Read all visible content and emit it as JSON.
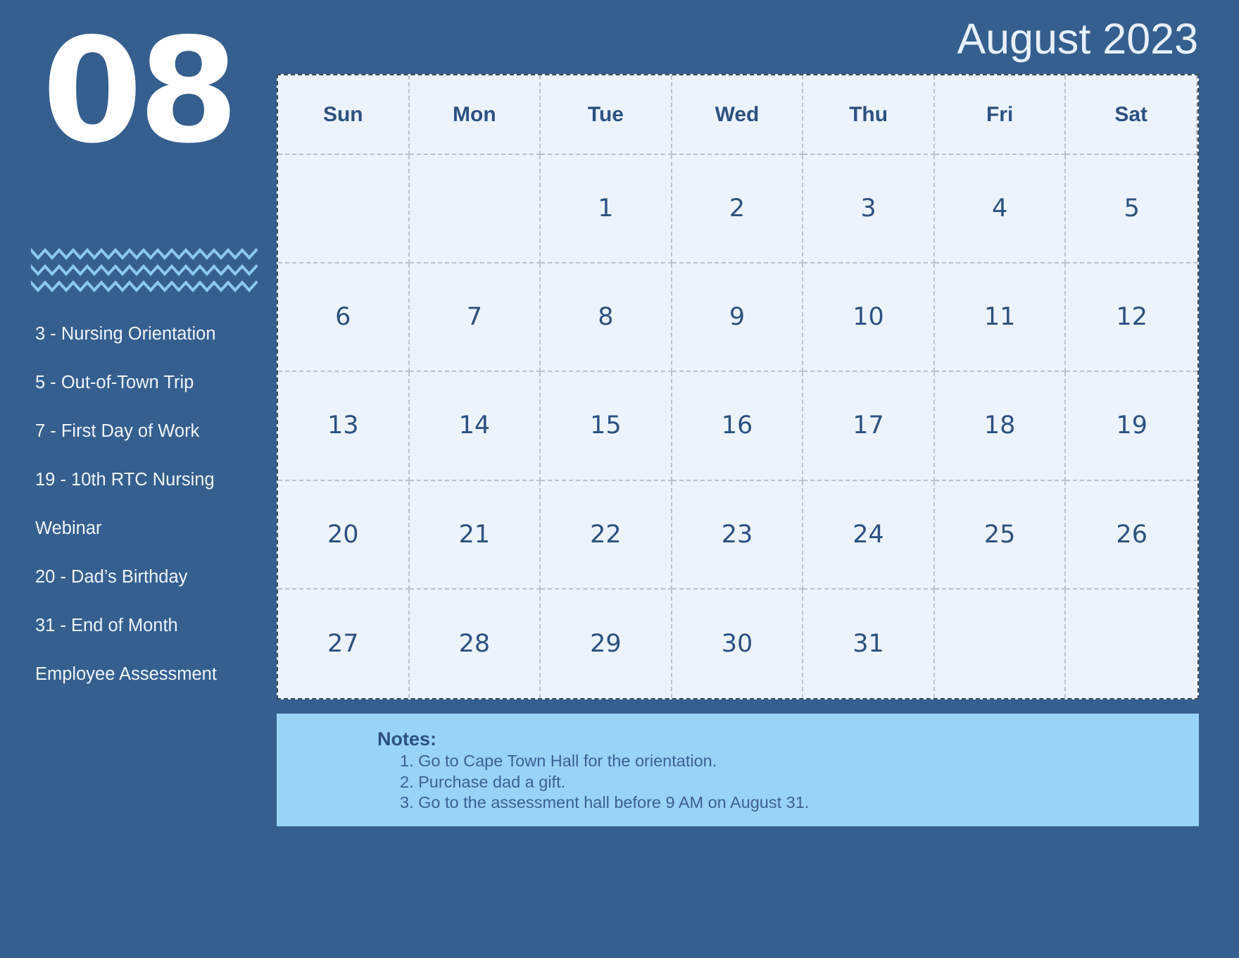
{
  "theme": {
    "background": "#355f8e",
    "grid_bg": "#edf3fc",
    "accent_text": "#2c5181",
    "notes_bg": "#99d3f5",
    "zigzag_color": "#8dc8ef",
    "light_text": "#eef4fb"
  },
  "sidebar": {
    "month_number": "08",
    "decoration": "zigzag-lines",
    "events": [
      "3 - Nursing Orientation",
      "5 - Out-of-Town Trip",
      "7 - First Day of Work",
      "19 - 10th RTC Nursing",
      "Webinar",
      "20 - Dad’s Birthday",
      "31 - End of Month",
      "Employee Assessment"
    ]
  },
  "header": {
    "title": "August 2023"
  },
  "calendar": {
    "weekdays": [
      "Sun",
      "Mon",
      "Tue",
      "Wed",
      "Thu",
      "Fri",
      "Sat"
    ],
    "weeks": [
      [
        "",
        "",
        "1",
        "2",
        "3",
        "4",
        "5"
      ],
      [
        "6",
        "7",
        "8",
        "9",
        "10",
        "11",
        "12"
      ],
      [
        "13",
        "14",
        "15",
        "16",
        "17",
        "18",
        "19"
      ],
      [
        "20",
        "21",
        "22",
        "23",
        "24",
        "25",
        "26"
      ],
      [
        "27",
        "28",
        "29",
        "30",
        "31",
        "",
        ""
      ]
    ]
  },
  "notes": {
    "title": "Notes:",
    "items": [
      "1. Go to Cape Town Hall for the orientation.",
      "2. Purchase dad a gift.",
      "3. Go to the assessment hall before 9 AM on August 31."
    ]
  }
}
